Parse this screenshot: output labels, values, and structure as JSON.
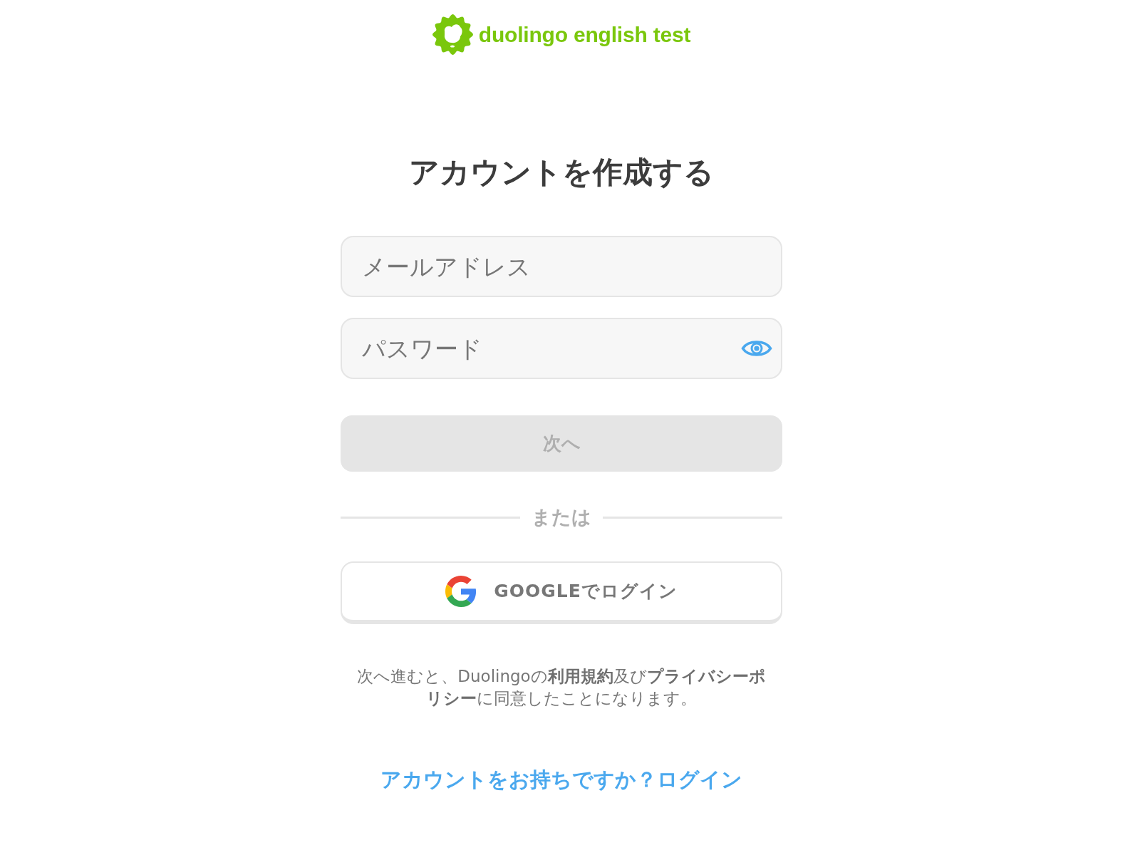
{
  "logo": {
    "text": "duolingo english test"
  },
  "title": "アカウントを作成する",
  "form": {
    "fields": [
      {
        "kind": "email",
        "placeholder": "メールアドレス"
      },
      {
        "kind": "password",
        "placeholder": "パスワード"
      }
    ],
    "next_button": {
      "label": "次へ",
      "disabled": true
    },
    "divider": "または",
    "google_button": {
      "label": "GOOGLEでログイン"
    }
  },
  "terms": "次へ進むと、Duolingoの**利用規約**及び**プライバシーポリシー**に同意したことになります。",
  "login_link": "アカウントをお持ちですか？ログイン"
}
